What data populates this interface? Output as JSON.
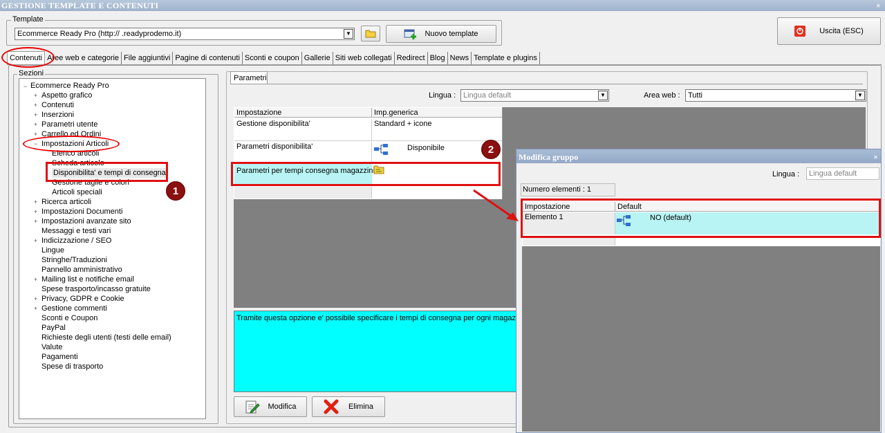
{
  "window": {
    "title": "GESTIONE TEMPLATE E CONTENUTI",
    "close_glyph": "×"
  },
  "template_group": {
    "label": "Template",
    "combo_value": "Ecommerce Ready Pro (http://     .readyprodemo.it)",
    "new_template_label": "Nuovo template",
    "exit_label": "Uscita (ESC)"
  },
  "tabs": [
    "Contenuti",
    "Aree web e categorie",
    "File aggiuntivi",
    "Pagine di contenuti",
    "Sconti e coupon",
    "Gallerie",
    "Siti web collegati",
    "Redirect",
    "Blog",
    "News",
    "Template e plugins"
  ],
  "sections": {
    "label": "Sezioni",
    "root": "Ecommerce Ready Pro",
    "items": [
      {
        "label": "Aspetto grafico",
        "toggle": "+"
      },
      {
        "label": "Contenuti",
        "toggle": "+"
      },
      {
        "label": "Inserzioni",
        "toggle": "+"
      },
      {
        "label": "Parametri utente",
        "toggle": "+"
      },
      {
        "label": "Carrello ed Ordini",
        "toggle": "+"
      },
      {
        "label": "Impostazioni Articoli",
        "toggle": "−"
      },
      {
        "label": "Elenco articoli",
        "toggle": "",
        "child": true
      },
      {
        "label": "Scheda articolo",
        "toggle": "",
        "child": true
      },
      {
        "label": "Disponibilita' e tempi di consegna",
        "toggle": "",
        "child": true,
        "selected": true
      },
      {
        "label": "Gestione taglie e colori",
        "toggle": "",
        "child": true
      },
      {
        "label": "Articoli speciali",
        "toggle": "",
        "child": true
      },
      {
        "label": "Ricerca articoli",
        "toggle": "+"
      },
      {
        "label": "Impostazioni Documenti",
        "toggle": "+"
      },
      {
        "label": "Impostazioni avanzate sito",
        "toggle": "+"
      },
      {
        "label": "Messaggi e testi vari",
        "toggle": ""
      },
      {
        "label": "Indicizzazione / SEO",
        "toggle": "+"
      },
      {
        "label": "Lingue",
        "toggle": ""
      },
      {
        "label": "Stringhe/Traduzioni",
        "toggle": ""
      },
      {
        "label": "Pannello amministrativo",
        "toggle": ""
      },
      {
        "label": "Mailing list e notifiche email",
        "toggle": "+"
      },
      {
        "label": "Spese trasporto/incasso gratuite",
        "toggle": ""
      },
      {
        "label": "Privacy, GDPR e Cookie",
        "toggle": "+"
      },
      {
        "label": "Gestione commenti",
        "toggle": "+"
      },
      {
        "label": "Sconti e Coupon",
        "toggle": ""
      },
      {
        "label": "PayPal",
        "toggle": ""
      },
      {
        "label": "Richieste degli utenti (testi delle email)",
        "toggle": ""
      },
      {
        "label": "Valute",
        "toggle": ""
      },
      {
        "label": "Pagamenti",
        "toggle": ""
      },
      {
        "label": "Spese di trasporto",
        "toggle": ""
      }
    ]
  },
  "params": {
    "tab_label": "Parametri",
    "lingua_label": "Lingua :",
    "lingua_value": "Lingua default",
    "area_label": "Area web :",
    "area_value": "Tutti",
    "col_setting": "Impostazione",
    "col_value": "Imp.generica",
    "rows": [
      {
        "setting": "Gestione disponibilita'",
        "value": "Standard + icone"
      },
      {
        "setting": "Parametri disponibilita'",
        "value": "Disponibile"
      },
      {
        "setting": "Parametri per tempi consegna magazzini",
        "value": ""
      }
    ],
    "description": "Tramite questa opzione e' possibile specificare i tempi di consegna per ogni magazzino",
    "modify_label": "Modifica",
    "delete_label": "Elimina"
  },
  "dialog": {
    "title": "Modifica gruppo",
    "lingua_label": "Lingua :",
    "lingua_value": "Lingua default",
    "count_label": "Numero elementi : 1",
    "col_setting": "Impostazione",
    "col_default": "Default",
    "row_setting": "Elemento 1",
    "row_default": "NO (default)"
  },
  "annotations": {
    "badge1": "1",
    "badge2": "2"
  },
  "colors": {
    "cyan": "#00ffff",
    "light_cyan": "#b8f4f4",
    "red": "#e01010",
    "badge": "#8b1010"
  }
}
